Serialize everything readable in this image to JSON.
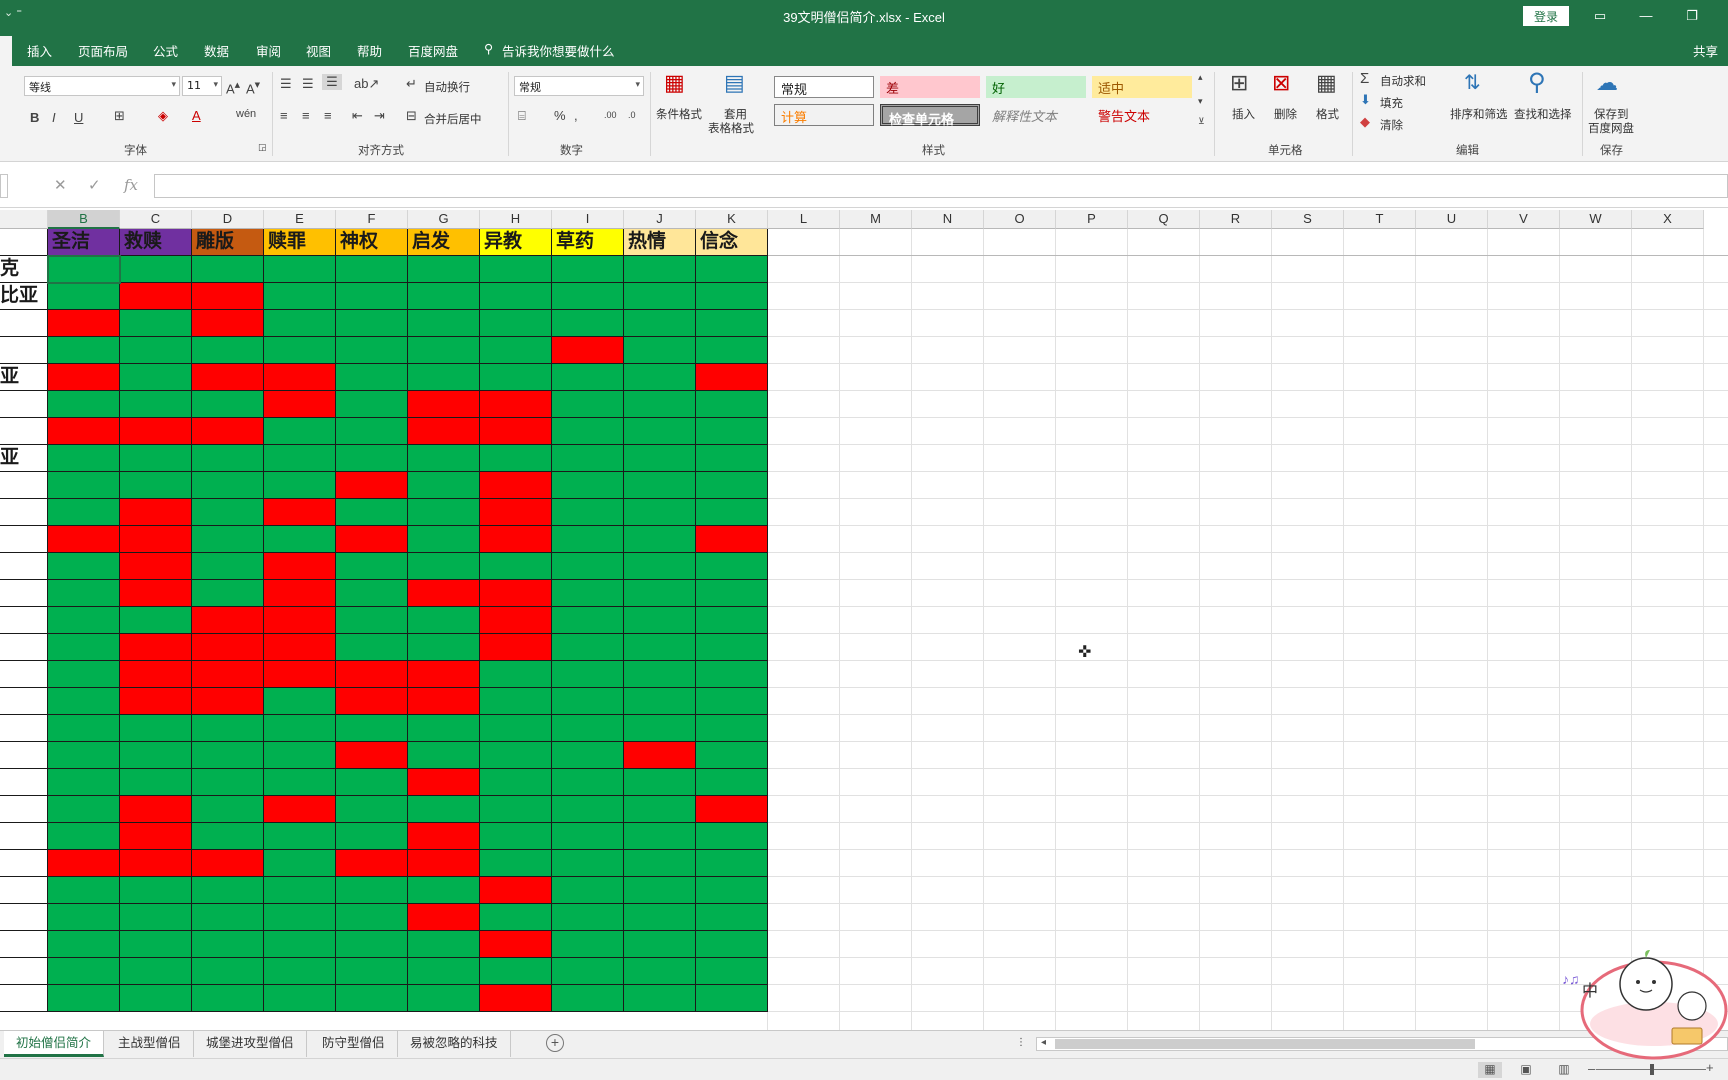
{
  "window": {
    "title": "39文明僧侣简介.xlsx  -  Excel",
    "login": "登录",
    "share": "共享"
  },
  "ribbon_tabs": [
    "插入",
    "页面布局",
    "公式",
    "数据",
    "审阅",
    "视图",
    "帮助",
    "百度网盘"
  ],
  "tell_me": "告诉我你想要做什么",
  "ribbon": {
    "font_name": "等线",
    "font_size": "11",
    "wrap_text": "自动换行",
    "merge_center": "合并后居中",
    "number_format": "常规",
    "conditional_format": "条件格式",
    "table_format_1": "套用",
    "table_format_2": "表格格式",
    "insert": "插入",
    "delete": "删除",
    "format": "格式",
    "autosum": "自动求和",
    "fill": "填充",
    "clear": "清除",
    "sort_filter": "排序和筛选",
    "find_select": "查找和选择",
    "save_baidu_1": "保存到",
    "save_baidu_2": "百度网盘",
    "groups": {
      "font": "字体",
      "alignment": "对齐方式",
      "number": "数字",
      "styles": "样式",
      "cells": "单元格",
      "editing": "编辑",
      "save": "保存"
    },
    "styles": {
      "normal": "常规",
      "bad": "差",
      "good": "好",
      "neutral": "适中",
      "calculation": "计算",
      "check_cell": "检查单元格",
      "explanatory": "解释性文本",
      "warning": "警告文本"
    }
  },
  "formula_bar": {
    "fx": "fx",
    "value": ""
  },
  "columns": {
    "visible_letters": [
      "B",
      "C",
      "D",
      "E",
      "F",
      "G",
      "H",
      "I",
      "J",
      "K",
      "L",
      "M",
      "N",
      "O",
      "P",
      "Q",
      "R",
      "S",
      "T",
      "U",
      "V",
      "W",
      "X"
    ],
    "selected": "B"
  },
  "table": {
    "headers": [
      {
        "text": "圣洁",
        "color": "#7030a0"
      },
      {
        "text": "救赎",
        "color": "#7030a0"
      },
      {
        "text": "雕版",
        "color": "#c55a11"
      },
      {
        "text": "赎罪",
        "color": "#ffc000"
      },
      {
        "text": "神权",
        "color": "#ffc000"
      },
      {
        "text": "启发",
        "color": "#ffc000"
      },
      {
        "text": "异教",
        "color": "#ffff00"
      },
      {
        "text": "草药",
        "color": "#ffff00"
      },
      {
        "text": "热情",
        "color": "#ffe699"
      },
      {
        "text": "信念",
        "color": "#ffe699"
      }
    ],
    "row_labels": [
      "克",
      "比亚",
      "",
      "",
      "亚",
      "",
      "",
      "亚",
      "",
      "",
      "",
      "",
      "",
      "",
      "",
      "",
      "",
      "",
      "",
      "",
      "",
      "",
      "",
      "",
      "",
      "",
      "",
      ""
    ],
    "legend_colors": {
      "G": "#00b050",
      "R": "#ff0000"
    },
    "cells": [
      "GGGGGGGGGG",
      "GRRGGGGGGG",
      "RGRGGGGGGG",
      "GGGGGGGRGG",
      "RGRRGGGGGR",
      "GGGRGRRGGG",
      "RRRGGRRGGG",
      "GGGGGGGGGG",
      "GGGGRGRGGG",
      "GRGRGGRGGG",
      "RRGGRGRGGR",
      "GRGRGGGGGG",
      "GRGRGRRGGG",
      "GGRRGGRGGG",
      "GRRRGGRGGG",
      "GRRRRRGGGG",
      "GRRGRRGGGG",
      "GGGGGGGGGG",
      "GGGGRGGGRG",
      "GGGGGRGGGG",
      "GRGRGGGGGR",
      "GRGGGRGGGG",
      "RRRGRRGGGG",
      "GGGGGGRGGG",
      "GGGGGRGGGG",
      "GGGGGGRGGG",
      "GGGGGGGGGG",
      "GGGGGGRGGG"
    ]
  },
  "sheet_tabs": [
    "初始僧侣简介",
    "主战型僧侣",
    "城堡进攻型僧侣",
    "防守型僧侣",
    "易被忽略的科技"
  ],
  "active_sheet": 0,
  "sticker_text": "中"
}
